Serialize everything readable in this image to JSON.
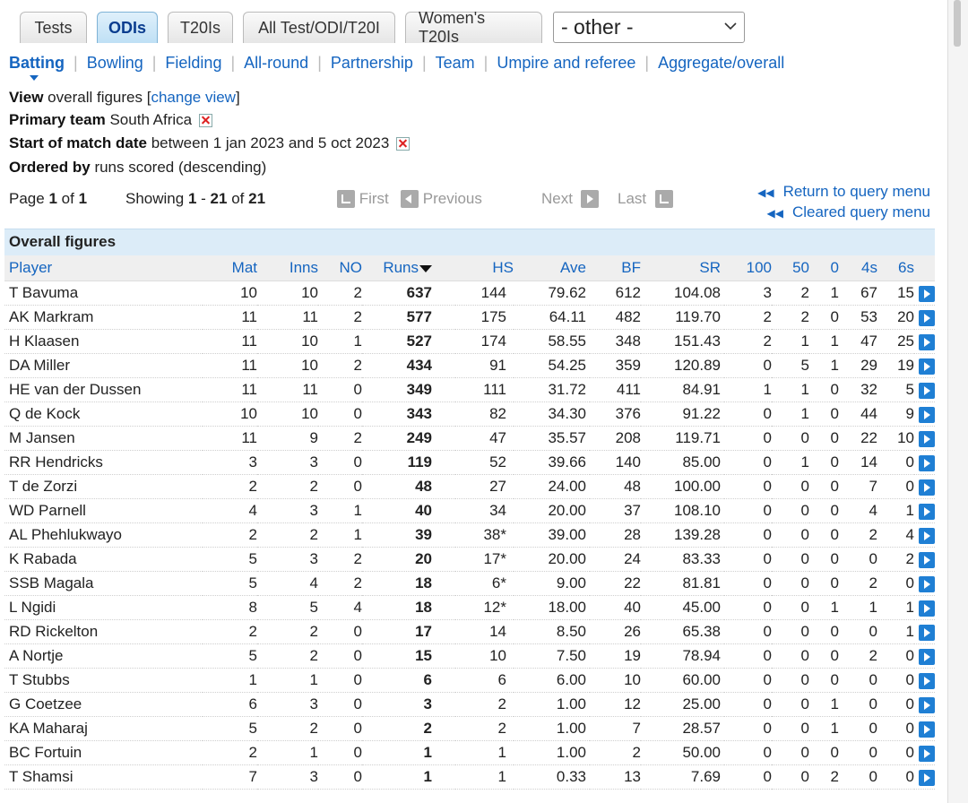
{
  "tabs": [
    {
      "label": "Tests",
      "active": false
    },
    {
      "label": "ODIs",
      "active": true
    },
    {
      "label": "T20Is",
      "active": false
    },
    {
      "label": "All Test/ODI/T20I",
      "active": false
    },
    {
      "label": "Women's T20Is",
      "active": false
    }
  ],
  "other_select": {
    "value": "- other -"
  },
  "subnav": [
    "Batting",
    "Bowling",
    "Fielding",
    "All-round",
    "Partnership",
    "Team",
    "Umpire and referee",
    "Aggregate/overall"
  ],
  "query": {
    "view_label": "View",
    "view_value": "overall figures",
    "change_view": "change view",
    "primary_team_label": "Primary team",
    "primary_team_value": "South Africa",
    "date_label": "Start of match date",
    "date_value": "between 1 jan 2023 and 5 oct 2023",
    "order_label": "Ordered by",
    "order_value": "runs scored (descending)"
  },
  "pager": {
    "page_label": "Page",
    "page": "1",
    "of": "of",
    "total_pages": "1",
    "showing_label": "Showing",
    "from": "1",
    "to": "21",
    "total": "21",
    "first": "First",
    "previous": "Previous",
    "next": "Next",
    "last": "Last"
  },
  "links": {
    "return": "Return to query menu",
    "cleared": "Cleared query menu"
  },
  "table": {
    "caption": "Overall figures",
    "headers": [
      "Player",
      "Mat",
      "Inns",
      "NO",
      "Runs",
      "HS",
      "Ave",
      "BF",
      "SR",
      "100",
      "50",
      "0",
      "4s",
      "6s"
    ],
    "rows": [
      [
        "T Bavuma",
        "10",
        "10",
        "2",
        "637",
        "144",
        "79.62",
        "612",
        "104.08",
        "3",
        "2",
        "1",
        "67",
        "15"
      ],
      [
        "AK Markram",
        "11",
        "11",
        "2",
        "577",
        "175",
        "64.11",
        "482",
        "119.70",
        "2",
        "2",
        "0",
        "53",
        "20"
      ],
      [
        "H Klaasen",
        "11",
        "10",
        "1",
        "527",
        "174",
        "58.55",
        "348",
        "151.43",
        "2",
        "1",
        "1",
        "47",
        "25"
      ],
      [
        "DA Miller",
        "11",
        "10",
        "2",
        "434",
        "91",
        "54.25",
        "359",
        "120.89",
        "0",
        "5",
        "1",
        "29",
        "19"
      ],
      [
        "HE van der Dussen",
        "11",
        "11",
        "0",
        "349",
        "111",
        "31.72",
        "411",
        "84.91",
        "1",
        "1",
        "0",
        "32",
        "5"
      ],
      [
        "Q de Kock",
        "10",
        "10",
        "0",
        "343",
        "82",
        "34.30",
        "376",
        "91.22",
        "0",
        "1",
        "0",
        "44",
        "9"
      ],
      [
        "M Jansen",
        "11",
        "9",
        "2",
        "249",
        "47",
        "35.57",
        "208",
        "119.71",
        "0",
        "0",
        "0",
        "22",
        "10"
      ],
      [
        "RR Hendricks",
        "3",
        "3",
        "0",
        "119",
        "52",
        "39.66",
        "140",
        "85.00",
        "0",
        "1",
        "0",
        "14",
        "0"
      ],
      [
        "T de Zorzi",
        "2",
        "2",
        "0",
        "48",
        "27",
        "24.00",
        "48",
        "100.00",
        "0",
        "0",
        "0",
        "7",
        "0"
      ],
      [
        "WD Parnell",
        "4",
        "3",
        "1",
        "40",
        "34",
        "20.00",
        "37",
        "108.10",
        "0",
        "0",
        "0",
        "4",
        "1"
      ],
      [
        "AL Phehlukwayo",
        "2",
        "2",
        "1",
        "39",
        "38*",
        "39.00",
        "28",
        "139.28",
        "0",
        "0",
        "0",
        "2",
        "4"
      ],
      [
        "K Rabada",
        "5",
        "3",
        "2",
        "20",
        "17*",
        "20.00",
        "24",
        "83.33",
        "0",
        "0",
        "0",
        "0",
        "2"
      ],
      [
        "SSB Magala",
        "5",
        "4",
        "2",
        "18",
        "6*",
        "9.00",
        "22",
        "81.81",
        "0",
        "0",
        "0",
        "2",
        "0"
      ],
      [
        "L Ngidi",
        "8",
        "5",
        "4",
        "18",
        "12*",
        "18.00",
        "40",
        "45.00",
        "0",
        "0",
        "1",
        "1",
        "1"
      ],
      [
        "RD Rickelton",
        "2",
        "2",
        "0",
        "17",
        "14",
        "8.50",
        "26",
        "65.38",
        "0",
        "0",
        "0",
        "0",
        "1"
      ],
      [
        "A Nortje",
        "5",
        "2",
        "0",
        "15",
        "10",
        "7.50",
        "19",
        "78.94",
        "0",
        "0",
        "0",
        "2",
        "0"
      ],
      [
        "T Stubbs",
        "1",
        "1",
        "0",
        "6",
        "6",
        "6.00",
        "10",
        "60.00",
        "0",
        "0",
        "0",
        "0",
        "0"
      ],
      [
        "G Coetzee",
        "6",
        "3",
        "0",
        "3",
        "2",
        "1.00",
        "12",
        "25.00",
        "0",
        "0",
        "1",
        "0",
        "0"
      ],
      [
        "KA Maharaj",
        "5",
        "2",
        "0",
        "2",
        "2",
        "1.00",
        "7",
        "28.57",
        "0",
        "0",
        "1",
        "0",
        "0"
      ],
      [
        "BC Fortuin",
        "2",
        "1",
        "0",
        "1",
        "1",
        "1.00",
        "2",
        "50.00",
        "0",
        "0",
        "0",
        "0",
        "0"
      ],
      [
        "T Shamsi",
        "7",
        "3",
        "0",
        "1",
        "1",
        "0.33",
        "13",
        "7.69",
        "0",
        "0",
        "2",
        "0",
        "0"
      ]
    ]
  }
}
